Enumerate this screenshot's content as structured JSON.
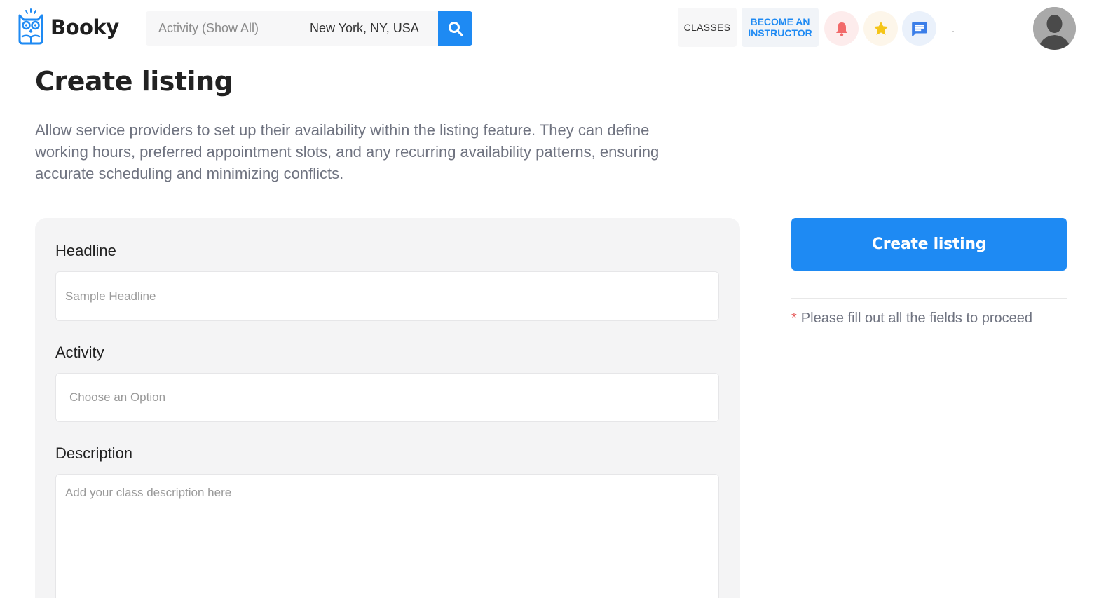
{
  "brand": {
    "name": "Booky",
    "accent": "#1e8af3"
  },
  "header": {
    "search": {
      "activity_placeholder": "Activity (Show All)",
      "location_value": "New York, NY, USA",
      "search_icon": "search-icon"
    },
    "classes_label": "CLASSES",
    "instructor_line1": "BECOME AN",
    "instructor_line2": "INSTRUCTOR",
    "icons": [
      "bell-icon",
      "star-icon",
      "chat-icon"
    ],
    "avatar_icon": "user-avatar"
  },
  "page": {
    "title": "Create listing",
    "description": "Allow service providers to set up their availability within the listing feature. They can define working hours, preferred appointment slots, and any recurring availability patterns, ensuring accurate scheduling and minimizing conflicts."
  },
  "form": {
    "headline": {
      "label": "Headline",
      "placeholder": "Sample Headline"
    },
    "activity": {
      "label": "Activity",
      "placeholder": "Choose an Option"
    },
    "description": {
      "label": "Description",
      "placeholder": "Add your class description here"
    }
  },
  "sidebar": {
    "create_button_label": "Create listing",
    "hint_asterisk": "*",
    "hint_text": "Please fill out all the fields to proceed"
  },
  "colors": {
    "primary": "#1e8af3",
    "bell": "#f26a6a",
    "star": "#f5c518",
    "chat": "#3b7ee8",
    "required": "#e55353"
  }
}
